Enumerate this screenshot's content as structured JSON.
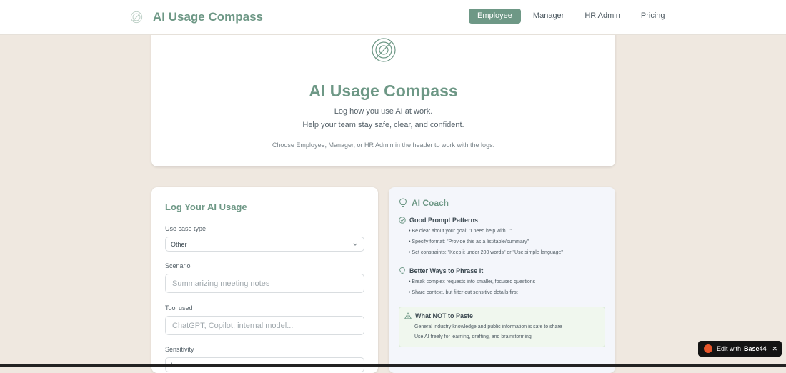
{
  "header": {
    "app_name": "AI Usage Compass",
    "nav": [
      {
        "label": "Employee",
        "active": true
      },
      {
        "label": "Manager",
        "active": false
      },
      {
        "label": "HR Admin",
        "active": false
      },
      {
        "label": "Pricing",
        "active": false
      }
    ]
  },
  "hero": {
    "title": "AI Usage Compass",
    "line1": "Log how you use AI at work.",
    "line2": "Help your team stay safe, clear, and confident.",
    "hint": "Choose Employee, Manager, or HR Admin in the header to work with the logs."
  },
  "log_form": {
    "title": "Log Your AI Usage",
    "use_case_label": "Use case type",
    "use_case_value": "Other",
    "scenario_label": "Scenario",
    "scenario_placeholder": "Summarizing meeting notes",
    "tool_label": "Tool used",
    "tool_placeholder": "ChatGPT, Copilot, internal model...",
    "sensitivity_label": "Sensitivity",
    "sensitivity_value": "Low"
  },
  "coach": {
    "title": "AI Coach",
    "good_title": "Good Prompt Patterns",
    "good_items": [
      "• Be clear about your goal: \"I need help with...\"",
      "• Specify format: \"Provide this as a list/table/summary\"",
      "• Set constraints: \"Keep it under 200 words\" or \"Use simple language\""
    ],
    "better_title": "Better Ways to Phrase It",
    "better_items": [
      "• Break complex requests into smaller, focused questions",
      "• Share context, but filter out sensitive details first"
    ],
    "warn_title": "What NOT to Paste",
    "warn_items": [
      "General industry knowledge and public information is safe to share",
      "Use AI freely for learning, drafting, and brainstorming"
    ]
  },
  "badge": {
    "edit_label": "Edit with",
    "brand": "Base44",
    "close": "✕"
  },
  "colors": {
    "accent": "#6e9886",
    "background": "#efe8e0",
    "coach_bg": "#f4f6fb",
    "warn_bg": "#f0f7ee"
  }
}
